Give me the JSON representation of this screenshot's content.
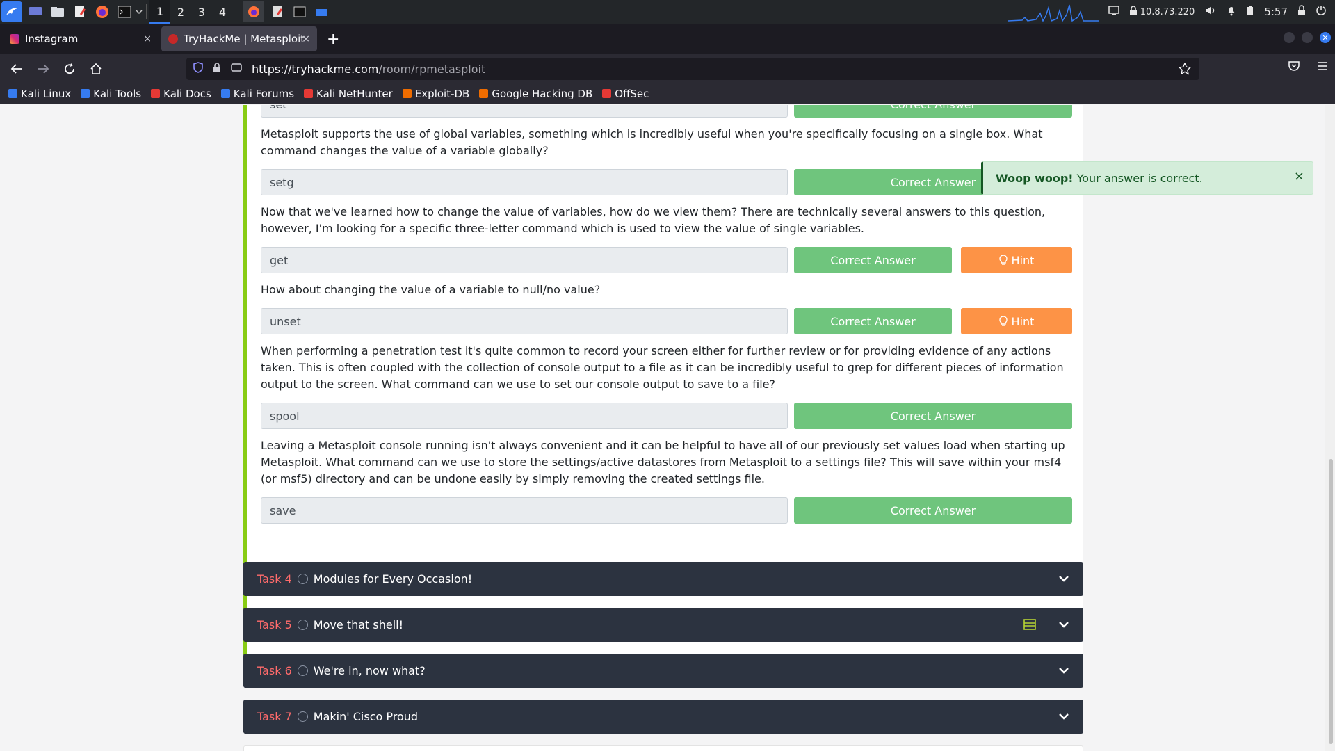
{
  "taskbar": {
    "workspaces": [
      "1",
      "2",
      "3",
      "4"
    ],
    "ip": "10.8.73.220",
    "clock": "5:57"
  },
  "browser": {
    "tabs": [
      {
        "title": "Instagram",
        "close": "×"
      },
      {
        "title": "TryHackMe | Metasploit",
        "close": "×"
      }
    ],
    "new_tab": "+",
    "url_host": "https://tryhackme.com",
    "url_path": "/room/rpmetasploit"
  },
  "bookmarks": [
    {
      "label": "Kali Linux",
      "color": "#367bf0"
    },
    {
      "label": "Kali Tools",
      "color": "#367bf0"
    },
    {
      "label": "Kali Docs",
      "color": "#e53935"
    },
    {
      "label": "Kali Forums",
      "color": "#367bf0"
    },
    {
      "label": "Kali NetHunter",
      "color": "#e53935"
    },
    {
      "label": "Exploit-DB",
      "color": "#ef6c00"
    },
    {
      "label": "Google Hacking DB",
      "color": "#ef6c00"
    },
    {
      "label": "OffSec",
      "color": "#e53935"
    }
  ],
  "questions": [
    {
      "text": "",
      "answer": "set",
      "button": "Correct Answer"
    },
    {
      "text": "Metasploit supports the use of global variables, something which is incredibly useful when you're specifically focusing on a single box. What command changes the value of a variable globally?",
      "answer": "setg",
      "button": "Correct Answer"
    },
    {
      "text": "Now that we've learned how to change the value of variables, how do we view them? There are technically several answers to this question, however, I'm looking for a specific three-letter command which is used to view the value of single variables.",
      "answer": "get",
      "button": "Correct Answer",
      "hint": "Hint"
    },
    {
      "text": "How about changing the value of a variable to null/no value?",
      "answer": "unset",
      "button": "Correct Answer",
      "hint": "Hint"
    },
    {
      "text": "When performing a penetration test it's quite common to record your screen either for further review or for providing evidence of any actions taken. This is often coupled with the collection of console output to a file as it can be incredibly useful to grep for different pieces of information output to the screen. What command can we use to set our console output to save to a file?",
      "answer": "spool",
      "button": "Correct Answer"
    },
    {
      "text": "Leaving a Metasploit console running isn't always convenient and it can be helpful to have all of our previously set values load when starting up Metasploit. What command can we use to store the settings/active datastores from Metasploit to a settings file? This will save within your msf4 (or msf5) directory and can be undone easily by simply removing the created settings file.",
      "answer": "save",
      "button": "Correct Answer"
    }
  ],
  "tasks": [
    {
      "number": "Task 4",
      "title": "Modules for Every Occasion!"
    },
    {
      "number": "Task 5",
      "title": "Move that shell!"
    },
    {
      "number": "Task 6",
      "title": "We're in, now what?"
    },
    {
      "number": "Task 7",
      "title": "Makin' Cisco Proud"
    }
  ],
  "toast": {
    "bold": "Woop woop!",
    "text": "Your answer is correct.",
    "close": "×"
  }
}
